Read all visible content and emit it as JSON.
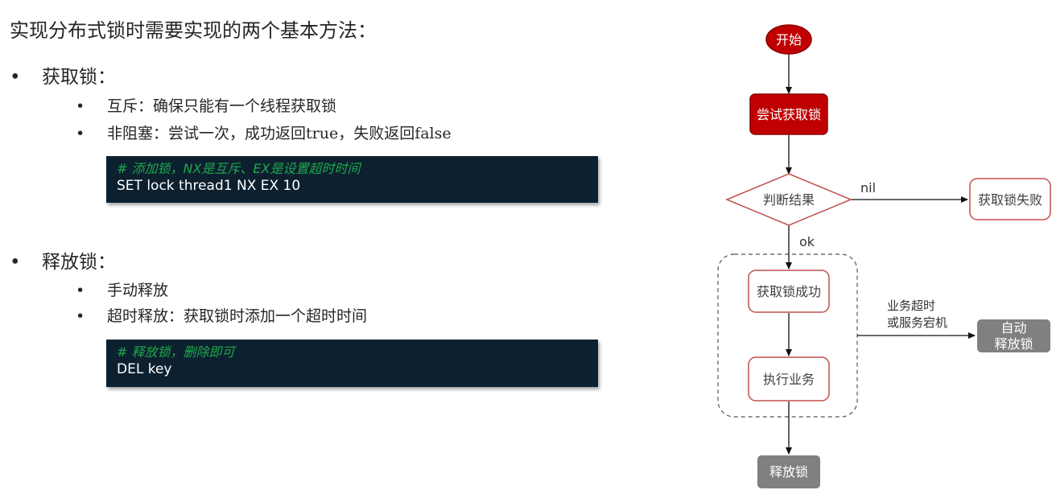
{
  "left": {
    "title": "实现分布式锁时需要实现的两个基本方法：",
    "acquire": {
      "heading": "获取锁：",
      "items": [
        "互斥：确保只能有一个线程获取锁",
        "非阻塞：尝试一次，成功返回true，失败返回false"
      ],
      "code_comment": "# 添加锁，NX是互斥、EX是设置超时时间",
      "code_command": "SET lock thread1 NX EX 10"
    },
    "release": {
      "heading": "释放锁：",
      "items": [
        "手动释放",
        "超时释放：获取锁时添加一个超时时间"
      ],
      "code_comment": "# 释放锁，删除即可",
      "code_command": "DEL key"
    },
    "bullet": "•"
  },
  "flow": {
    "start": "开始",
    "try_lock": "尝试获取锁",
    "decision": "判断结果",
    "nil_label": "nil",
    "fail": "获取锁失败",
    "ok_label": "ok",
    "success": "获取锁成功",
    "execute": "执行业务",
    "timeout_line1": "业务超时",
    "timeout_line2": "或服务宕机",
    "auto_line1": "自动",
    "auto_line2": "释放锁",
    "release": "释放锁"
  },
  "colors": {
    "red_fill": "#c00000",
    "red_stroke": "#c0504d",
    "dark_stroke": "#8b0000",
    "gray_fill": "#808080",
    "code_bg": "#0d2030",
    "code_comment": "#1ea84a"
  }
}
